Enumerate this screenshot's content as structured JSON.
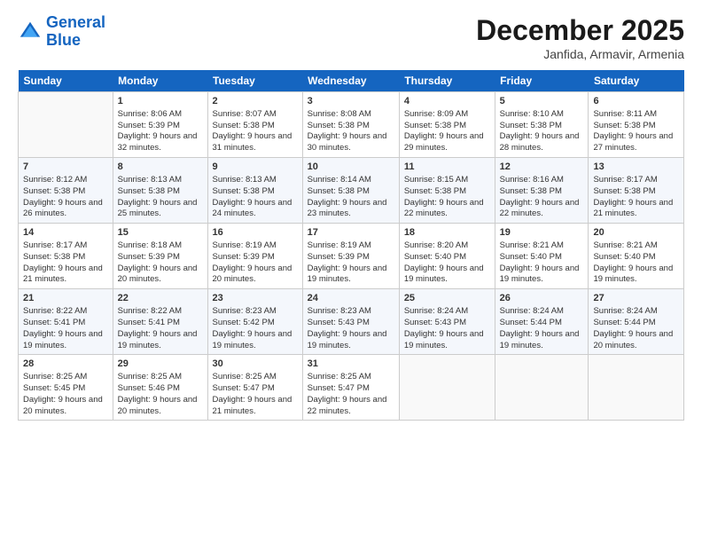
{
  "header": {
    "logo_line1": "General",
    "logo_line2": "Blue",
    "month": "December 2025",
    "location": "Janfida, Armavir, Armenia"
  },
  "weekdays": [
    "Sunday",
    "Monday",
    "Tuesday",
    "Wednesday",
    "Thursday",
    "Friday",
    "Saturday"
  ],
  "weeks": [
    [
      {
        "day": "",
        "sunrise": "",
        "sunset": "",
        "daylight": ""
      },
      {
        "day": "1",
        "sunrise": "Sunrise: 8:06 AM",
        "sunset": "Sunset: 5:39 PM",
        "daylight": "Daylight: 9 hours and 32 minutes."
      },
      {
        "day": "2",
        "sunrise": "Sunrise: 8:07 AM",
        "sunset": "Sunset: 5:38 PM",
        "daylight": "Daylight: 9 hours and 31 minutes."
      },
      {
        "day": "3",
        "sunrise": "Sunrise: 8:08 AM",
        "sunset": "Sunset: 5:38 PM",
        "daylight": "Daylight: 9 hours and 30 minutes."
      },
      {
        "day": "4",
        "sunrise": "Sunrise: 8:09 AM",
        "sunset": "Sunset: 5:38 PM",
        "daylight": "Daylight: 9 hours and 29 minutes."
      },
      {
        "day": "5",
        "sunrise": "Sunrise: 8:10 AM",
        "sunset": "Sunset: 5:38 PM",
        "daylight": "Daylight: 9 hours and 28 minutes."
      },
      {
        "day": "6",
        "sunrise": "Sunrise: 8:11 AM",
        "sunset": "Sunset: 5:38 PM",
        "daylight": "Daylight: 9 hours and 27 minutes."
      }
    ],
    [
      {
        "day": "7",
        "sunrise": "Sunrise: 8:12 AM",
        "sunset": "Sunset: 5:38 PM",
        "daylight": "Daylight: 9 hours and 26 minutes."
      },
      {
        "day": "8",
        "sunrise": "Sunrise: 8:13 AM",
        "sunset": "Sunset: 5:38 PM",
        "daylight": "Daylight: 9 hours and 25 minutes."
      },
      {
        "day": "9",
        "sunrise": "Sunrise: 8:13 AM",
        "sunset": "Sunset: 5:38 PM",
        "daylight": "Daylight: 9 hours and 24 minutes."
      },
      {
        "day": "10",
        "sunrise": "Sunrise: 8:14 AM",
        "sunset": "Sunset: 5:38 PM",
        "daylight": "Daylight: 9 hours and 23 minutes."
      },
      {
        "day": "11",
        "sunrise": "Sunrise: 8:15 AM",
        "sunset": "Sunset: 5:38 PM",
        "daylight": "Daylight: 9 hours and 22 minutes."
      },
      {
        "day": "12",
        "sunrise": "Sunrise: 8:16 AM",
        "sunset": "Sunset: 5:38 PM",
        "daylight": "Daylight: 9 hours and 22 minutes."
      },
      {
        "day": "13",
        "sunrise": "Sunrise: 8:17 AM",
        "sunset": "Sunset: 5:38 PM",
        "daylight": "Daylight: 9 hours and 21 minutes."
      }
    ],
    [
      {
        "day": "14",
        "sunrise": "Sunrise: 8:17 AM",
        "sunset": "Sunset: 5:38 PM",
        "daylight": "Daylight: 9 hours and 21 minutes."
      },
      {
        "day": "15",
        "sunrise": "Sunrise: 8:18 AM",
        "sunset": "Sunset: 5:39 PM",
        "daylight": "Daylight: 9 hours and 20 minutes."
      },
      {
        "day": "16",
        "sunrise": "Sunrise: 8:19 AM",
        "sunset": "Sunset: 5:39 PM",
        "daylight": "Daylight: 9 hours and 20 minutes."
      },
      {
        "day": "17",
        "sunrise": "Sunrise: 8:19 AM",
        "sunset": "Sunset: 5:39 PM",
        "daylight": "Daylight: 9 hours and 19 minutes."
      },
      {
        "day": "18",
        "sunrise": "Sunrise: 8:20 AM",
        "sunset": "Sunset: 5:40 PM",
        "daylight": "Daylight: 9 hours and 19 minutes."
      },
      {
        "day": "19",
        "sunrise": "Sunrise: 8:21 AM",
        "sunset": "Sunset: 5:40 PM",
        "daylight": "Daylight: 9 hours and 19 minutes."
      },
      {
        "day": "20",
        "sunrise": "Sunrise: 8:21 AM",
        "sunset": "Sunset: 5:40 PM",
        "daylight": "Daylight: 9 hours and 19 minutes."
      }
    ],
    [
      {
        "day": "21",
        "sunrise": "Sunrise: 8:22 AM",
        "sunset": "Sunset: 5:41 PM",
        "daylight": "Daylight: 9 hours and 19 minutes."
      },
      {
        "day": "22",
        "sunrise": "Sunrise: 8:22 AM",
        "sunset": "Sunset: 5:41 PM",
        "daylight": "Daylight: 9 hours and 19 minutes."
      },
      {
        "day": "23",
        "sunrise": "Sunrise: 8:23 AM",
        "sunset": "Sunset: 5:42 PM",
        "daylight": "Daylight: 9 hours and 19 minutes."
      },
      {
        "day": "24",
        "sunrise": "Sunrise: 8:23 AM",
        "sunset": "Sunset: 5:43 PM",
        "daylight": "Daylight: 9 hours and 19 minutes."
      },
      {
        "day": "25",
        "sunrise": "Sunrise: 8:24 AM",
        "sunset": "Sunset: 5:43 PM",
        "daylight": "Daylight: 9 hours and 19 minutes."
      },
      {
        "day": "26",
        "sunrise": "Sunrise: 8:24 AM",
        "sunset": "Sunset: 5:44 PM",
        "daylight": "Daylight: 9 hours and 19 minutes."
      },
      {
        "day": "27",
        "sunrise": "Sunrise: 8:24 AM",
        "sunset": "Sunset: 5:44 PM",
        "daylight": "Daylight: 9 hours and 20 minutes."
      }
    ],
    [
      {
        "day": "28",
        "sunrise": "Sunrise: 8:25 AM",
        "sunset": "Sunset: 5:45 PM",
        "daylight": "Daylight: 9 hours and 20 minutes."
      },
      {
        "day": "29",
        "sunrise": "Sunrise: 8:25 AM",
        "sunset": "Sunset: 5:46 PM",
        "daylight": "Daylight: 9 hours and 20 minutes."
      },
      {
        "day": "30",
        "sunrise": "Sunrise: 8:25 AM",
        "sunset": "Sunset: 5:47 PM",
        "daylight": "Daylight: 9 hours and 21 minutes."
      },
      {
        "day": "31",
        "sunrise": "Sunrise: 8:25 AM",
        "sunset": "Sunset: 5:47 PM",
        "daylight": "Daylight: 9 hours and 22 minutes."
      },
      {
        "day": "",
        "sunrise": "",
        "sunset": "",
        "daylight": ""
      },
      {
        "day": "",
        "sunrise": "",
        "sunset": "",
        "daylight": ""
      },
      {
        "day": "",
        "sunrise": "",
        "sunset": "",
        "daylight": ""
      }
    ]
  ]
}
